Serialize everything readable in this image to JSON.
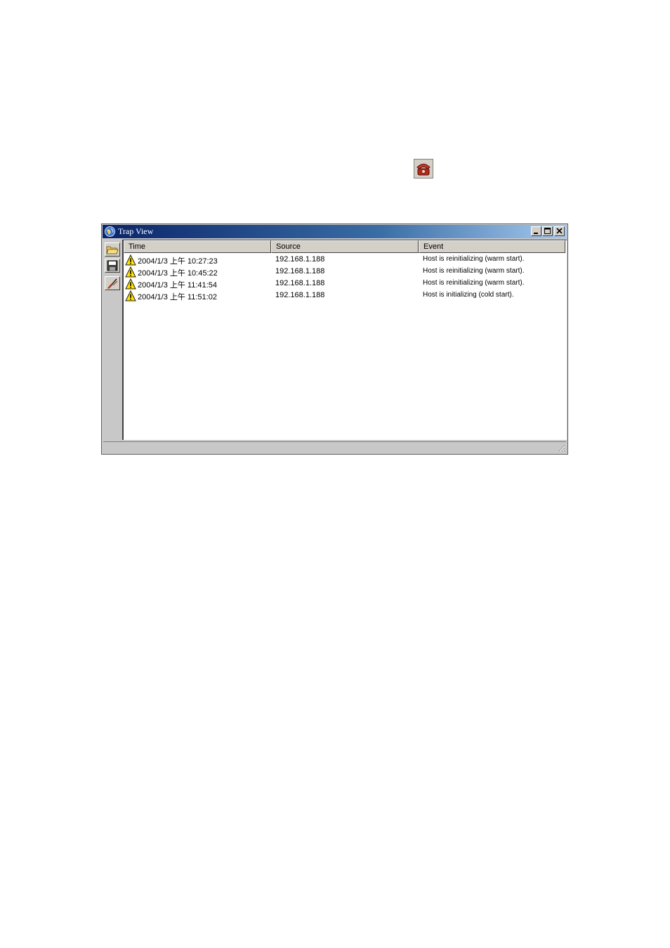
{
  "window": {
    "title": "Trap View"
  },
  "table": {
    "headers": {
      "time": "Time",
      "source": "Source",
      "event": "Event"
    },
    "rows": [
      {
        "time": "2004/1/3 上午 10:27:23",
        "source": "192.168.1.188",
        "event": "Host is reinitializing (warm start)."
      },
      {
        "time": "2004/1/3 上午 10:45:22",
        "source": "192.168.1.188",
        "event": "Host is reinitializing (warm start)."
      },
      {
        "time": "2004/1/3 上午 11:41:54",
        "source": "192.168.1.188",
        "event": "Host is reinitializing (warm start)."
      },
      {
        "time": "2004/1/3 上午 11:51:02",
        "source": "192.168.1.188",
        "event": "Host is initializing (cold start)."
      }
    ]
  },
  "icons": {
    "trap_view_launcher": "telephone-icon",
    "row_icon": "warning-icon",
    "toolbar": [
      "open-folder-icon",
      "save-disk-icon",
      "clear-icon"
    ]
  }
}
